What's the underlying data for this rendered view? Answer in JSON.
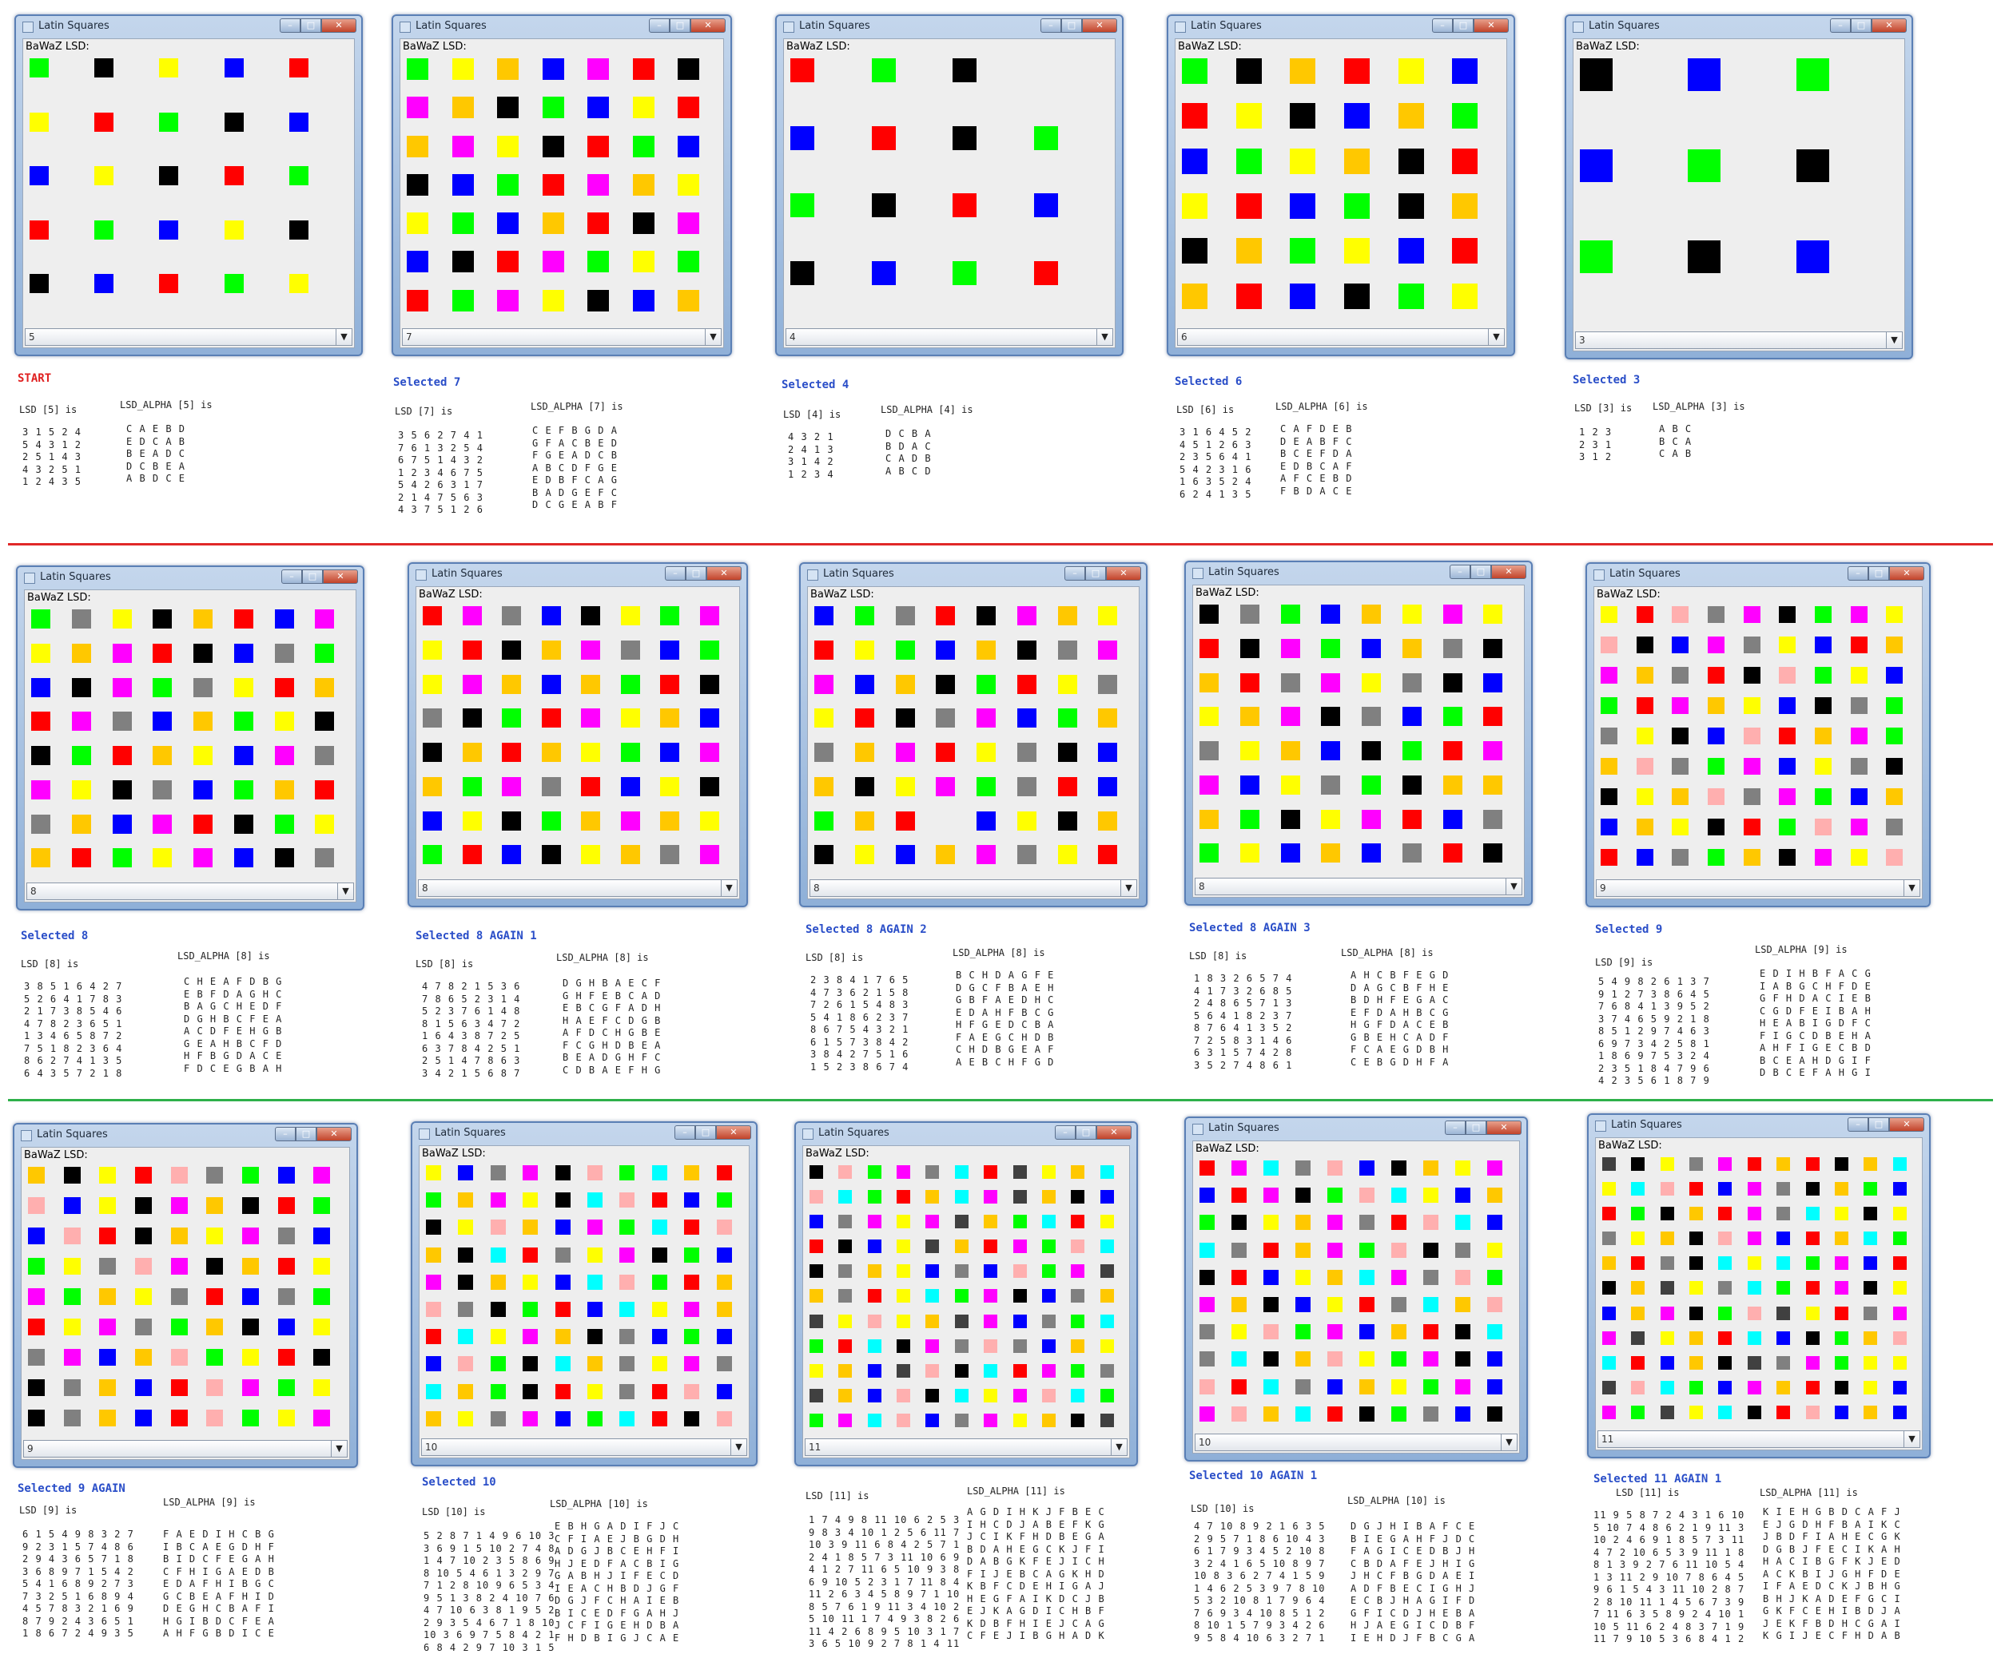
{
  "app": {
    "window_title": "Latin Squares",
    "panel_label": "BaWaZ LSD:",
    "min_glyph": "–",
    "max_glyph": "□",
    "close_glyph": "✕",
    "dropdown_glyph": "▼"
  },
  "colors": {
    "title_bar": "#8fb0d8",
    "client_bg": "#eeeeee",
    "caption_blue": "#2a4ec8",
    "caption_red": "#e02020",
    "separator_red": "#e02828",
    "separator_green": "#2eb04a"
  },
  "palette": {
    "G": "#00ff00",
    "K": "#000000",
    "Y": "#ffff00",
    "B": "#0000ff",
    "R": "#ff0000",
    "M": "#ff00ff",
    "O": "#ffc800",
    "D": "#808080",
    "P": "#ffafaf",
    "C": "#00ffff",
    "S": "#404040"
  },
  "panels": [
    {
      "caption": "START",
      "selected": "5",
      "lsd_label": "LSD [5] is",
      "alpha_label": "LSD_ALPHA [5] is",
      "lsd": [
        "3 1 5 2 4",
        "5 4 3 1 2",
        "2 5 1 4 3",
        "4 3 2 5 1",
        "1 2 4 3 5"
      ],
      "alpha": [
        "C A E B D",
        "E D C A B",
        "B E A D C",
        "D C B E A",
        "A B D C E"
      ],
      "grid": [
        "GKYBR",
        "YRGKB",
        "BYKRG",
        "RGBYK",
        "KBRGY"
      ]
    },
    {
      "caption": "Selected 7",
      "selected": "7",
      "lsd_label": "LSD [7] is",
      "alpha_label": "LSD_ALPHA [7] is",
      "lsd": [
        "3 5 6 2 7 4 1",
        "7 6 1 3 2 5 4",
        "6 7 5 1 4 3 2",
        "1 2 3 4 6 7 5",
        "5 4 2 6 3 1 7",
        "2 1 4 7 5 6 3",
        "4 3 7 5 1 2 6"
      ],
      "alpha": [
        "C E F B G D A",
        "G F A C B E D",
        "F G E A D C B",
        "A B C D F G E",
        "E D B F C A G",
        "B A D G E F C",
        "D C G E A B F"
      ],
      "grid": [
        "GYOBMRK",
        "MOKGBYR",
        "OMYKRGB",
        "KBGRMOY",
        "YGBORKM",
        "BKRMGYG",
        "RGMYKBO"
      ]
    },
    {
      "caption": "Selected 4",
      "selected": "4",
      "lsd_label": "LSD [4] is",
      "alpha_label": "LSD_ALPHA [4] is",
      "lsd": [
        "4 3 2 1",
        "2 4 1 3",
        "3 1 4 2",
        "1 2 3 4"
      ],
      "alpha": [
        "D C B A",
        "B D A C",
        "C A D B",
        "A B C D"
      ],
      "grid": [
        "RGKW",
        "BRKG",
        "GKRB",
        "KBGR"
      ]
    },
    {
      "caption": "Selected 6",
      "selected": "6",
      "lsd_label": "LSD [6] is",
      "alpha_label": "LSD_ALPHA [6] is",
      "lsd": [
        "3 1 6 4 5 2",
        "4 5 1 2 6 3",
        "2 3 5 6 4 1",
        "5 4 2 3 1 6",
        "1 6 3 5 2 4",
        "6 2 4 1 3 5"
      ],
      "alpha": [
        "C A F D E B",
        "D E A B F C",
        "B C E F D A",
        "E D B C A F",
        "A F C E B D",
        "F B D A C E"
      ],
      "grid": [
        "GKORYB",
        "RYKBOG",
        "BGYOKR",
        "YRBGKO",
        "KOGYBR",
        "ORBKGY"
      ]
    },
    {
      "caption": "Selected 3",
      "selected": "3",
      "lsd_label": "LSD [3] is",
      "alpha_label": "LSD_ALPHA [3] is",
      "lsd": [
        "1 2 3",
        "2 3 1",
        "3 1 2"
      ],
      "alpha": [
        "A B C",
        "B C A",
        "C A B"
      ],
      "grid": [
        "KBG",
        "BGK",
        "GKB"
      ]
    },
    {
      "caption": "Selected 8",
      "selected": "8",
      "lsd_label": "LSD [8] is",
      "alpha_label": "LSD_ALPHA [8] is",
      "lsd": [
        "3 8 5 1 6 4 2 7",
        "5 2 6 4 1 7 8 3",
        "2 1 7 3 8 5 4 6",
        "4 7 8 2 3 6 5 1",
        "1 3 4 6 5 8 7 2",
        "7 5 1 8 2 3 6 4",
        "8 6 2 7 4 1 3 5",
        "6 4 3 5 7 2 1 8"
      ],
      "alpha": [
        "C H E A F D B G",
        "E B F D A G H C",
        "B A G C H E D F",
        "D G H B C F E A",
        "A C D F E H G B",
        "G E A H B C F D",
        "H F B G D A C E",
        "F D C E G B A H"
      ],
      "grid": [
        "GDYKORBM",
        "YOMRKBDG",
        "BKMGDYRO",
        "RMDBOGYK",
        "KGROYBMD",
        "MYKDBGOR",
        "DOBMRKGY",
        "ORGYMBKD"
      ]
    },
    {
      "caption": "Selected 8 AGAIN 1",
      "selected": "8",
      "lsd_label": "LSD [8] is",
      "alpha_label": "LSD_ALPHA [8] is",
      "lsd": [
        "4 7 8 2 1 5 3 6",
        "7 8 6 5 2 3 1 4",
        "5 2 3 7 6 1 4 8",
        "8 1 5 6 3 4 7 2",
        "1 6 4 3 8 7 2 5",
        "6 3 7 8 4 2 5 1",
        "2 5 1 4 7 8 6 3",
        "3 4 2 1 5 6 8 7"
      ],
      "alpha": [
        "D G H B A E C F",
        "G H F E B C A D",
        "E B C G F A D H",
        "H A E F C D G B",
        "A F D C H G B E",
        "F C G H D B E A",
        "B E A D G H F C",
        "C D B A E F H G"
      ],
      "grid": [
        "RMDBKYGM",
        "YRKOMDBG",
        "YMOBOGRK",
        "DKGRMYOB",
        "KOROYGBM",
        "OGMDRBYK",
        "BYKGOMOY",
        "GRBKYODM"
      ]
    },
    {
      "caption": "Selected 8 AGAIN 2",
      "selected": "8",
      "lsd_label": "LSD [8] is",
      "alpha_label": "LSD_ALPHA [8] is",
      "lsd": [
        "2 3 8 4 1 7 6 5",
        "4 7 3 6 2 1 5 8",
        "7 2 6 1 5 4 8 3",
        "5 4 1 8 6 2 3 7",
        "8 6 7 5 4 3 2 1",
        "6 1 5 7 3 8 4 2",
        "3 8 4 2 7 5 1 6",
        "1 5 2 3 8 6 7 4"
      ],
      "alpha": [
        "B C H D A G F E",
        "D G C F B A E H",
        "G B F A E D H C",
        "E D A H F B C G",
        "H F G E D C B A",
        "F A E G C H D B",
        "C H D B G E A F",
        "A E B C H F G D"
      ],
      "grid": [
        "BGDRKMOY",
        "RYGBOKDM",
        "MBOKGRYD",
        "YRKDMBGO",
        "DOMRYDKB",
        "OKYMGDRB",
        "GOREBYKO",
        "KYBOMDYR"
      ]
    },
    {
      "caption": "Selected 8 AGAIN 3",
      "selected": "8",
      "lsd_label": "LSD [8] is",
      "alpha_label": "LSD_ALPHA [8] is",
      "lsd": [
        "1 8 3 2 6 5 7 4",
        "4 1 7 3 2 6 8 5",
        "2 4 8 6 5 7 1 3",
        "5 6 4 1 8 2 3 7",
        "8 7 6 4 1 3 5 2",
        "7 2 5 8 3 1 4 6",
        "6 3 1 5 7 4 2 8",
        "3 5 2 7 4 8 6 1"
      ],
      "alpha": [
        "A H C B F E G D",
        "D A G C B F H E",
        "B D H F E G A C",
        "E F D A H B C G",
        "H G F D A C E B",
        "G B E H C A D F",
        "F C A E G D B H",
        "C E B G D H F A"
      ],
      "grid": [
        "KDGBOYMY",
        "RKMGBODK",
        "ORDMYDKB",
        "YOMKDBGR",
        "DYOBKGRM",
        "MBYDGKOO",
        "OGKYMRBD",
        "GYBOBDRK"
      ]
    },
    {
      "caption": "Selected 9",
      "selected": "9",
      "lsd_label": "LSD [9] is",
      "alpha_label": "LSD_ALPHA [9] is",
      "lsd": [
        "5 4 9 8 2 6 1 3 7",
        "9 1 2 7 3 8 6 4 5",
        "7 6 8 4 1 3 9 5 2",
        "3 7 4 6 5 9 2 1 8",
        "8 5 1 2 9 7 4 6 3",
        "6 9 7 3 4 2 5 8 1",
        "1 8 6 9 7 5 3 2 4",
        "2 3 5 1 8 4 7 9 6",
        "4 2 3 5 6 1 8 7 9"
      ],
      "alpha": [
        "E D I H B F A C G",
        "I A B G C H F D E",
        "G F H D A C I E B",
        "C G D F E I B A H",
        "H E A B I G D F C",
        "F I G C D B E H A",
        "A H F I G E C B D",
        "B C E A H D G I F",
        "D B C E F A H G I"
      ],
      "grid": [
        "YRPDMKGMY",
        "PKBMDYBRO",
        "MODRKPGYB",
        "GRMOYBKDG",
        "DYKBPROMG",
        "OPDGMBYDK",
        "KYOPDMGBO",
        "BOYKRGPMD",
        "RBDGOKMYP"
      ]
    },
    {
      "caption": "Selected 9 AGAIN",
      "selected": "9",
      "lsd_label": "LSD [9] is",
      "alpha_label": "LSD_ALPHA [9] is",
      "lsd": [
        "6 1 5 4 9 8 3 2 7",
        "9 2 3 1 5 7 4 8 6",
        "2 9 4 3 6 5 7 1 8",
        "3 6 8 9 7 1 5 4 2",
        "5 4 1 6 8 9 2 7 3",
        "7 3 2 5 1 6 8 9 4",
        "4 5 7 8 3 2 1 6 9",
        "8 7 9 2 4 3 6 5 1",
        "1 8 6 7 2 4 9 3 5"
      ],
      "alpha": [
        "F A E D I H C B G",
        "I B C A E G D H F",
        "B I D C F E G A H",
        "C F H I G A E D B",
        "E D A F H I B G C",
        "G C B E A F H I D",
        "D E G H C B A F I",
        "H G I B D C F E A",
        "A H F G B D I C E"
      ],
      "grid": [
        "OKYRPDGBM",
        "PBYKMOKRG",
        "BPRKOYMDB",
        "GYDPMKORY",
        "MGOYDRBDG",
        "RYMDGOKBY",
        "DMBOPGYRK",
        "KDOBRPMGY",
        "KDOBRPGYM"
      ]
    },
    {
      "caption": "Selected 10",
      "selected": "10",
      "lsd_label": "LSD [10] is",
      "alpha_label": "LSD_ALPHA [10] is",
      "lsd": [
        "5 2 8 7 1 4 9 6 10 3",
        "3 6 9 1 5 10 2 7 4 8",
        "1 4 7 10 2 3 5 8 6 9",
        "8 10 5 4 6 1 3 2 9 7",
        "7 1 2 8 10 9 6 5 3 4",
        "9 5 1 3 8 2 4 10 7 6",
        "4 7 10 6 3 8 1 9 5 2",
        "2 9 3 5 4 6 7 1 8 10",
        "10 3 6 9 7 5 8 4 2 1",
        "6 8 4 2 9 7 10 3 1 5"
      ],
      "alpha": [
        "E B H G A D I F J C",
        "C F I A E J B G D H",
        "A D G J B C E H F I",
        "H J E D F A C B I G",
        "G A B H J I F E C D",
        "I E A C H B D J G F",
        "D G J F C H A I E B",
        "B I C E D F G A H J",
        "J C F I G E H D B A",
        "F H D B I G J C A E"
      ],
      "grid": [
        "YBDMKPGCOR",
        "GOMYKCPRBG",
        "KYPOBMGCRP",
        "OKCRDYMKGB",
        "MKOYBCPGRO",
        "PDKGRBCYMO",
        "RCYMOKDBGB",
        "BPGKCODYMD",
        "COGKRYDRPB",
        "OYDMBGCRKP"
      ]
    },
    {
      "caption": "",
      "selected": "11",
      "lsd_label": "LSD [11] is",
      "alpha_label": "LSD_ALPHA [11] is",
      "lsd": [
        "1 7 4 9 8 11 10 6 2 5 3",
        "9 8 3 4 10 1 2 5 6 11 7",
        "10 3 9 11 6 8 4 2 5 7 1",
        "2 4 1 8 5 7 3 11 10 6 9",
        "4 1 2 7 11 6 5 10 9 3 8",
        "6 9 10 5 2 3 1 7 11 8 4",
        "11 2 6 3 4 5 8 9 7 1 10",
        "8 5 7 6 1 9 11 3 4 10 2",
        "5 10 11 1 7 4 9 3 8 2 6",
        "11 4 2 6 8 9 5 10 3 1 7",
        "3 6 5 10 9 2 7 8 1 4 11"
      ],
      "alpha": [
        "A G D I H K J F B E C",
        "I H C D J A B E F K G",
        "J C I K F H D B E G A",
        "B D A H E G C K J F I",
        "D A B G K F E J I C H",
        "F I J E B C A G K H D",
        "K B F C D E H I G A J",
        "H E G F A I K D C J B",
        "E J K A G D I C H B F",
        "K D B F H I E J C A G",
        "C F E J I B G H A D K"
      ],
      "grid": [
        "KPGMDCRSYOC",
        "PCGROCMSOKB",
        "BDMYMSOGCRY",
        "RKBYSORMGPC",
        "KDOYBDBPGMS",
        "ODRYCGMKBDO",
        "SYPYOSMBDGC",
        "GRCKMDPDBOY",
        "YOBSPKCRMGD",
        "SOBPKCYMPCG",
        "GMCPBDMYOKS"
      ]
    },
    {
      "caption": "Selected 10 AGAIN 1",
      "selected": "10",
      "lsd_label": "LSD [10] is",
      "alpha_label": "LSD_ALPHA [10] is",
      "lsd": [
        "4 7 10 8 9 2 1 6 3 5",
        "2 9 5 7 1 8 6 10 4 3",
        "6 1 7 9 3 4 5 2 10 8",
        "3 2 4 1 6 5 10 8 9 7",
        "10 8 3 6 2 7 4 1 5 9",
        "1 4 6 2 5 3 9 7 8 10",
        "5 3 2 10 8 1 7 9 6 4",
        "7 6 9 3 4 10 8 5 1 2",
        "8 10 1 5 7 9 3 4 2 6",
        "9 5 8 4 10 6 3 2 7 1"
      ],
      "alpha": [
        "D G J H I B A F C E",
        "B I E G A H F J D C",
        "F A G I C E D B J H",
        "C B D A F E J H I G",
        "J H C F B G D A E I",
        "A D F B E C I G H J",
        "E C B J H A G I F D",
        "G F I C D J H E B A",
        "H J A E G I C D B F",
        "I E H D J F B C G A"
      ],
      "grid": [
        "RMCDPBKOYM",
        "BRMKGPCYBO",
        "GKYOMDRPCB",
        "CDROMGPKDY",
        "KRBYOCMDPG",
        "MOKBYRDCOP",
        "DYPGMBORKC",
        "DCKOPYGMKB",
        "PRCDBOYGMB",
        "MPOCRKGDBK"
      ]
    },
    {
      "caption": "Selected 11 AGAIN 1",
      "selected": "11",
      "lsd_label": "LSD [11] is",
      "alpha_label": "LSD_ALPHA [11] is",
      "lsd": [
        "11 9 5 8 7 2 4 3 1 6 10",
        "5 10 7 4 8 6 2 1 9 11 3",
        "10 2 4 6 9 1 8 5 7 3 11",
        "4 7 2 10 6 5 3 9 11 1 8",
        "8 1 3 9 2 7 6 11 10 5 4",
        "1 3 11 2 9 10 7 8 6 4 5",
        "9 6 1 5 4 3 11 10 2 8 7",
        "2 8 10 11 1 4 5 6 7 3 9",
        "7 11 6 3 5 8 9 2 4 10 1",
        "10 5 11 6 2 4 8 3 7 1 9",
        "11 7 9 10 5 3 6 8 4 1 2"
      ],
      "alpha": [
        "K I E H G B D C A F J",
        "E J G D H F B A I K C",
        "J B D F I A H E C G K",
        "D G B J F E C I K A H",
        "H A C I B G F K J E D",
        "A C K B I J G H F D E",
        "I F A E D C K J B H G",
        "B H J K A D E F G C I",
        "G K F C E H I B D J A",
        "J E K F B D H C G A I",
        "K G I J E C F H D A B"
      ],
      "grid": [
        "SKYDMRORKOC",
        "YCPRBMDKOGB",
        "RGKORMDCYKY",
        "DYOKPMBROCG",
        "ORDKCYCGMBR",
        "KOSYDCGRMKY",
        "BOMKGPSYRDM",
        "MSYORCBKGOP",
        "CRBOKSDMGYY",
        "SPCGBMORKYB",
        "MGSYCKRPBOB"
      ]
    }
  ]
}
